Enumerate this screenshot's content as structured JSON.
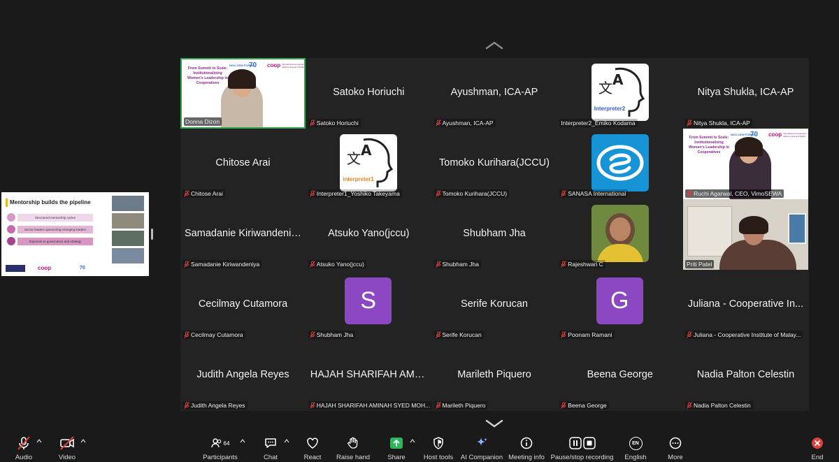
{
  "colors": {
    "background": "#1a1a1a",
    "tile": "#232323",
    "active_border": "#2fa84f",
    "mic_off": "#e0403a",
    "avatar_purple": "#8b48c2"
  },
  "tiles": [
    {
      "name": "",
      "label": "Donna Dizon",
      "type": "video-slide"
    },
    {
      "name": "Satoko Horiuchi",
      "label": "Satoko Horiuchi",
      "type": "name"
    },
    {
      "name": "Ayushman, ICA-AP",
      "label": "Ayushman, ICA-AP",
      "type": "name"
    },
    {
      "name": "",
      "label": "Interpreter2_Emiko Kodama",
      "type": "interpreter",
      "badge": "Interpreter2"
    },
    {
      "name": "Nitya Shukla, ICA-AP",
      "label": "Nitya Shukla, ICA-AP",
      "type": "name"
    },
    {
      "name": "Chitose Arai",
      "label": "Chitose Arai",
      "type": "name"
    },
    {
      "name": "",
      "label": "Interpreter1_Yoshiko Takeyama",
      "type": "interpreter",
      "badge": "interpreter1"
    },
    {
      "name": "Tomoko Kurihara(JCCU)",
      "label": "Tomoko Kurihara(JCCU)",
      "type": "name"
    },
    {
      "name": "",
      "label": "SANASA International",
      "type": "logo"
    },
    {
      "name": "",
      "label": "Ruchi Agarwal, CEO, VimoSEWA",
      "type": "video-slide2"
    },
    {
      "name": "Samadanie Kiriwandeniya",
      "label": "Samadanie Kiriwandeniya",
      "type": "name"
    },
    {
      "name": "Atsuko Yano(jccu)",
      "label": "Atsuko Yano(jccu)",
      "type": "name"
    },
    {
      "name": "Shubham Jha",
      "label": "Shubham Jha",
      "type": "name"
    },
    {
      "name": "",
      "label": "Rajeshwari C",
      "type": "photo"
    },
    {
      "name": "",
      "label": "Priti Patel",
      "type": "video-room"
    },
    {
      "name": "Cecilmay Cutamora",
      "label": "Cecilmay Cutamora",
      "type": "name"
    },
    {
      "name": "",
      "label": "Shubham Jha",
      "type": "letter",
      "letter": "S"
    },
    {
      "name": "Serife Korucan",
      "label": "Serife Korucan",
      "type": "name"
    },
    {
      "name": "",
      "label": "Poonam Ramani",
      "type": "letter",
      "letter": "G"
    },
    {
      "name": "Juliana - Cooperative In...",
      "label": "Juliana - Cooperative Institute of Malay...",
      "type": "name"
    },
    {
      "name": "Judith Angela Reyes",
      "label": "Judith Angela Reyes",
      "type": "name"
    },
    {
      "name": "HAJAH SHARIFAH AMIN...",
      "label": "HAJAH SHARIFAH AMINAH SYED MOH...",
      "type": "name"
    },
    {
      "name": "Marileth Piquero",
      "label": "Marileth Piquero",
      "type": "name"
    },
    {
      "name": "Beena George",
      "label": "Beena George",
      "type": "name"
    },
    {
      "name": "Nadia Palton Celestin",
      "label": "Nadia Palton Celestin",
      "type": "name"
    }
  ],
  "slide": {
    "title": "From Summit to Scale: Institutionalising Women's Leadership in Cooperatives",
    "forum": "NGO-CEW FORUM",
    "num": "70",
    "coop": "coop",
    "coop_sub": "International Cooperative Alliance",
    "coop_sub2": "Asia and Pacific"
  },
  "share": {
    "title": "Mentorship builds the pipeline",
    "items": [
      "Structured mentorship cycles",
      "Senior leaders sponsoring emerging leaders",
      "Exposure to governance and strategy"
    ]
  },
  "toolbar": {
    "audio": "Audio",
    "video": "Video",
    "participants": "Participants",
    "participants_count": "64",
    "chat": "Chat",
    "react": "React",
    "raise_hand": "Raise hand",
    "share": "Share",
    "host_tools": "Host tools",
    "ai_companion": "AI Companion",
    "meeting_info": "Meeting info",
    "recording": "Pause/stop recording",
    "language": "English",
    "language_code": "EN",
    "more": "More",
    "end": "End"
  }
}
